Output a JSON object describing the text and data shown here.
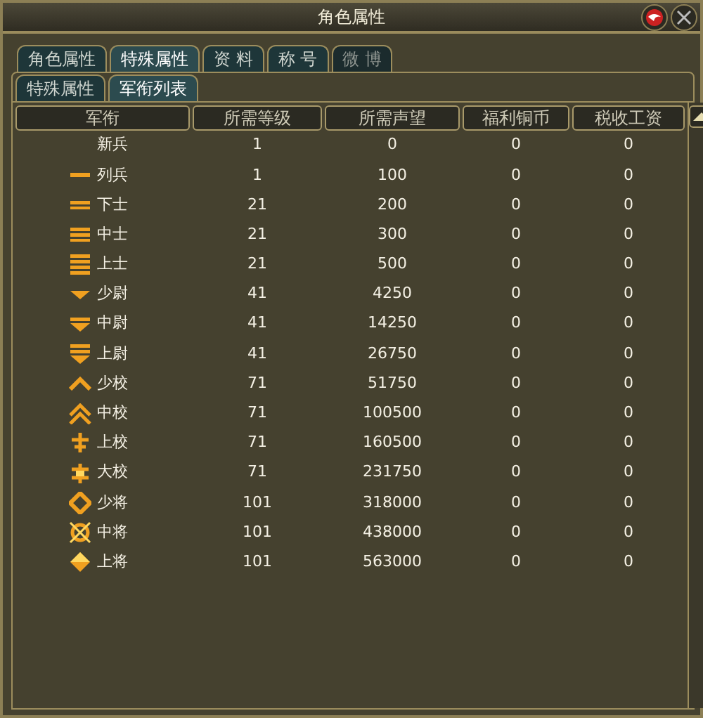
{
  "window": {
    "title": "角色属性"
  },
  "tabs": [
    {
      "label": "角色属性",
      "selected": false
    },
    {
      "label": "特殊属性",
      "selected": true
    },
    {
      "label": "资 料",
      "selected": false
    },
    {
      "label": "称 号",
      "selected": false
    },
    {
      "label": "微 博",
      "selected": false,
      "disabled": true
    }
  ],
  "subtabs": [
    {
      "label": "特殊属性",
      "selected": false
    },
    {
      "label": "军衔列表",
      "selected": true
    }
  ],
  "table": {
    "columns": [
      "军衔",
      "所需等级",
      "所需声望",
      "福利铜币",
      "税收工资"
    ],
    "rows": [
      {
        "kind": "plain",
        "rank": "新兵",
        "level": "1",
        "reputation": "0",
        "welfare": "0",
        "tax": "0"
      },
      {
        "kind": "bar1",
        "rank": "列兵",
        "level": "1",
        "reputation": "100",
        "welfare": "0",
        "tax": "0"
      },
      {
        "kind": "bar2",
        "rank": "下士",
        "level": "21",
        "reputation": "200",
        "welfare": "0",
        "tax": "0"
      },
      {
        "kind": "bar3",
        "rank": "中士",
        "level": "21",
        "reputation": "300",
        "welfare": "0",
        "tax": "0"
      },
      {
        "kind": "bar4",
        "rank": "上士",
        "level": "21",
        "reputation": "500",
        "welfare": "0",
        "tax": "0"
      },
      {
        "kind": "vee1",
        "rank": "少尉",
        "level": "41",
        "reputation": "4250",
        "welfare": "0",
        "tax": "0"
      },
      {
        "kind": "vee2",
        "rank": "中尉",
        "level": "41",
        "reputation": "14250",
        "welfare": "0",
        "tax": "0"
      },
      {
        "kind": "vee3",
        "rank": "上尉",
        "level": "41",
        "reputation": "26750",
        "welfare": "0",
        "tax": "0"
      },
      {
        "kind": "chev1",
        "rank": "少校",
        "level": "71",
        "reputation": "51750",
        "welfare": "0",
        "tax": "0"
      },
      {
        "kind": "chev2",
        "rank": "中校",
        "level": "71",
        "reputation": "100500",
        "welfare": "0",
        "tax": "0"
      },
      {
        "kind": "cross1",
        "rank": "上校",
        "level": "71",
        "reputation": "160500",
        "welfare": "0",
        "tax": "0"
      },
      {
        "kind": "cross2",
        "rank": "大校",
        "level": "71",
        "reputation": "231750",
        "welfare": "0",
        "tax": "0"
      },
      {
        "kind": "diamond",
        "rank": "少将",
        "level": "101",
        "reputation": "318000",
        "welfare": "0",
        "tax": "0"
      },
      {
        "kind": "ring",
        "rank": "中将",
        "level": "101",
        "reputation": "438000",
        "welfare": "0",
        "tax": "0"
      },
      {
        "kind": "gem",
        "rank": "上将",
        "level": "101",
        "reputation": "563000",
        "welfare": "0",
        "tax": "0"
      }
    ]
  }
}
